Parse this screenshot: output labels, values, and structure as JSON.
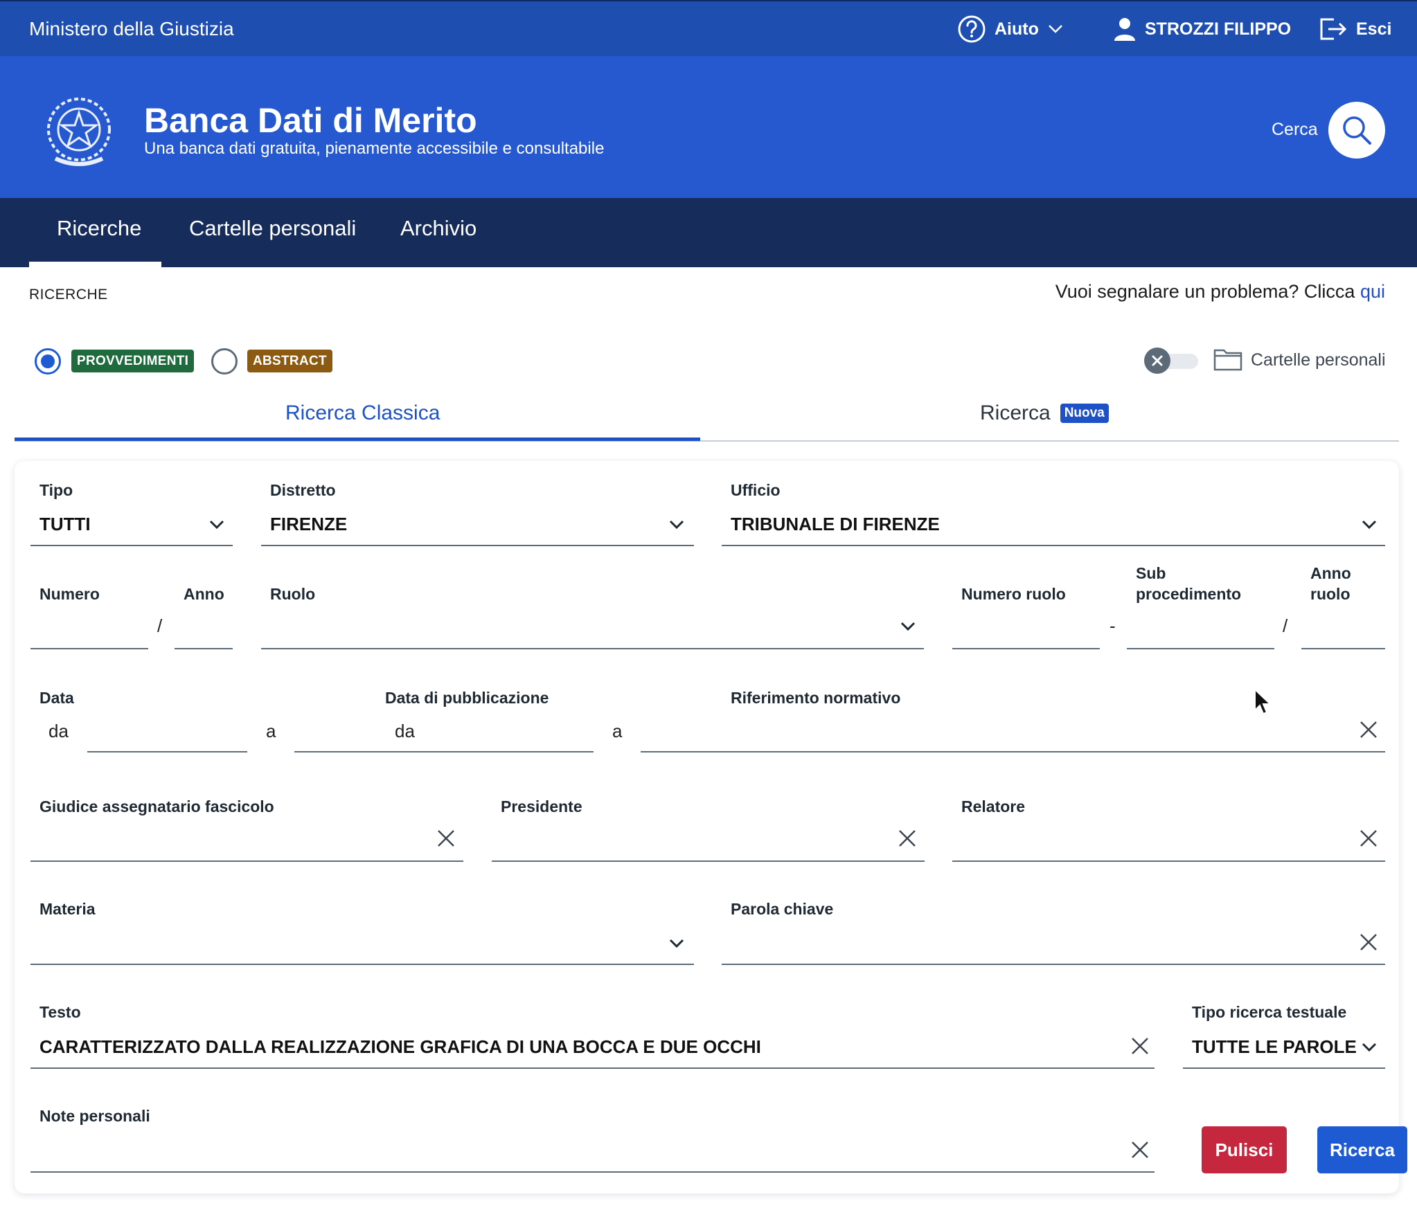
{
  "topbar": {
    "org": "Ministero della Giustizia",
    "help_label": "Aiuto",
    "user_name": "STROZZI FILIPPO",
    "logout_label": "Esci"
  },
  "header": {
    "title": "Banca Dati di Merito",
    "subtitle": "Una banca dati gratuita, pienamente accessibile e consultabile",
    "search_label": "Cerca"
  },
  "nav": {
    "items": [
      {
        "label": "Ricerche"
      },
      {
        "label": "Cartelle personali"
      },
      {
        "label": "Archivio"
      }
    ]
  },
  "breadcrumb": "RICERCHE",
  "report": {
    "text": "Vuoi segnalare un problema? Clicca",
    "link": "qui"
  },
  "source": {
    "provvedimenti": "PROVVEDIMENTI",
    "abstract": "ABSTRACT",
    "selected": "PROVVEDIMENTI"
  },
  "folders_label": "Cartelle personali",
  "tabs": {
    "classic": "Ricerca Classica",
    "new": "Ricerca",
    "new_badge": "Nuova"
  },
  "form": {
    "tipo": {
      "label": "Tipo",
      "value": "TUTTI"
    },
    "distretto": {
      "label": "Distretto",
      "value": "FIRENZE"
    },
    "ufficio": {
      "label": "Ufficio",
      "value": "TRIBUNALE DI FIRENZE"
    },
    "numero": {
      "label": "Numero"
    },
    "anno": {
      "label": "Anno"
    },
    "ruolo": {
      "label": "Ruolo"
    },
    "numero_ruolo": {
      "label": "Numero ruolo"
    },
    "sub_procedimento": {
      "label_line1": "Sub",
      "label_line2": "procedimento"
    },
    "anno_ruolo": {
      "label_line1": "Anno",
      "label_line2": "ruolo"
    },
    "data": {
      "label": "Data",
      "from": "da",
      "to": "a"
    },
    "data_pubblicazione": {
      "label": "Data di pubblicazione",
      "from": "da",
      "to": "a"
    },
    "riferimento_normativo": {
      "label": "Riferimento normativo"
    },
    "giudice": {
      "label": "Giudice assegnatario fascicolo"
    },
    "presidente": {
      "label": "Presidente"
    },
    "relatore": {
      "label": "Relatore"
    },
    "materia": {
      "label": "Materia"
    },
    "parola_chiave": {
      "label": "Parola chiave"
    },
    "testo": {
      "label": "Testo",
      "value": "CARATTERIZZATO DALLA REALIZZAZIONE GRAFICA DI UNA BOCCA E DUE OCCHI"
    },
    "tipo_ricerca_testuale": {
      "label": "Tipo ricerca testuale",
      "value": "TUTTE LE PAROLE"
    },
    "note_personali": {
      "label": "Note personali"
    },
    "separators": {
      "slash": "/",
      "dash": "-"
    }
  },
  "buttons": {
    "clear": "Pulisci",
    "search": "Ricerca"
  },
  "colors": {
    "topbar": "#1e4fb0",
    "header": "#2659d0",
    "nav": "#162d5c",
    "accent": "#1e50c6",
    "provvedimenti_badge": "#1f6b3d",
    "abstract_badge": "#8c5a10",
    "clear_button": "#c5283e"
  }
}
